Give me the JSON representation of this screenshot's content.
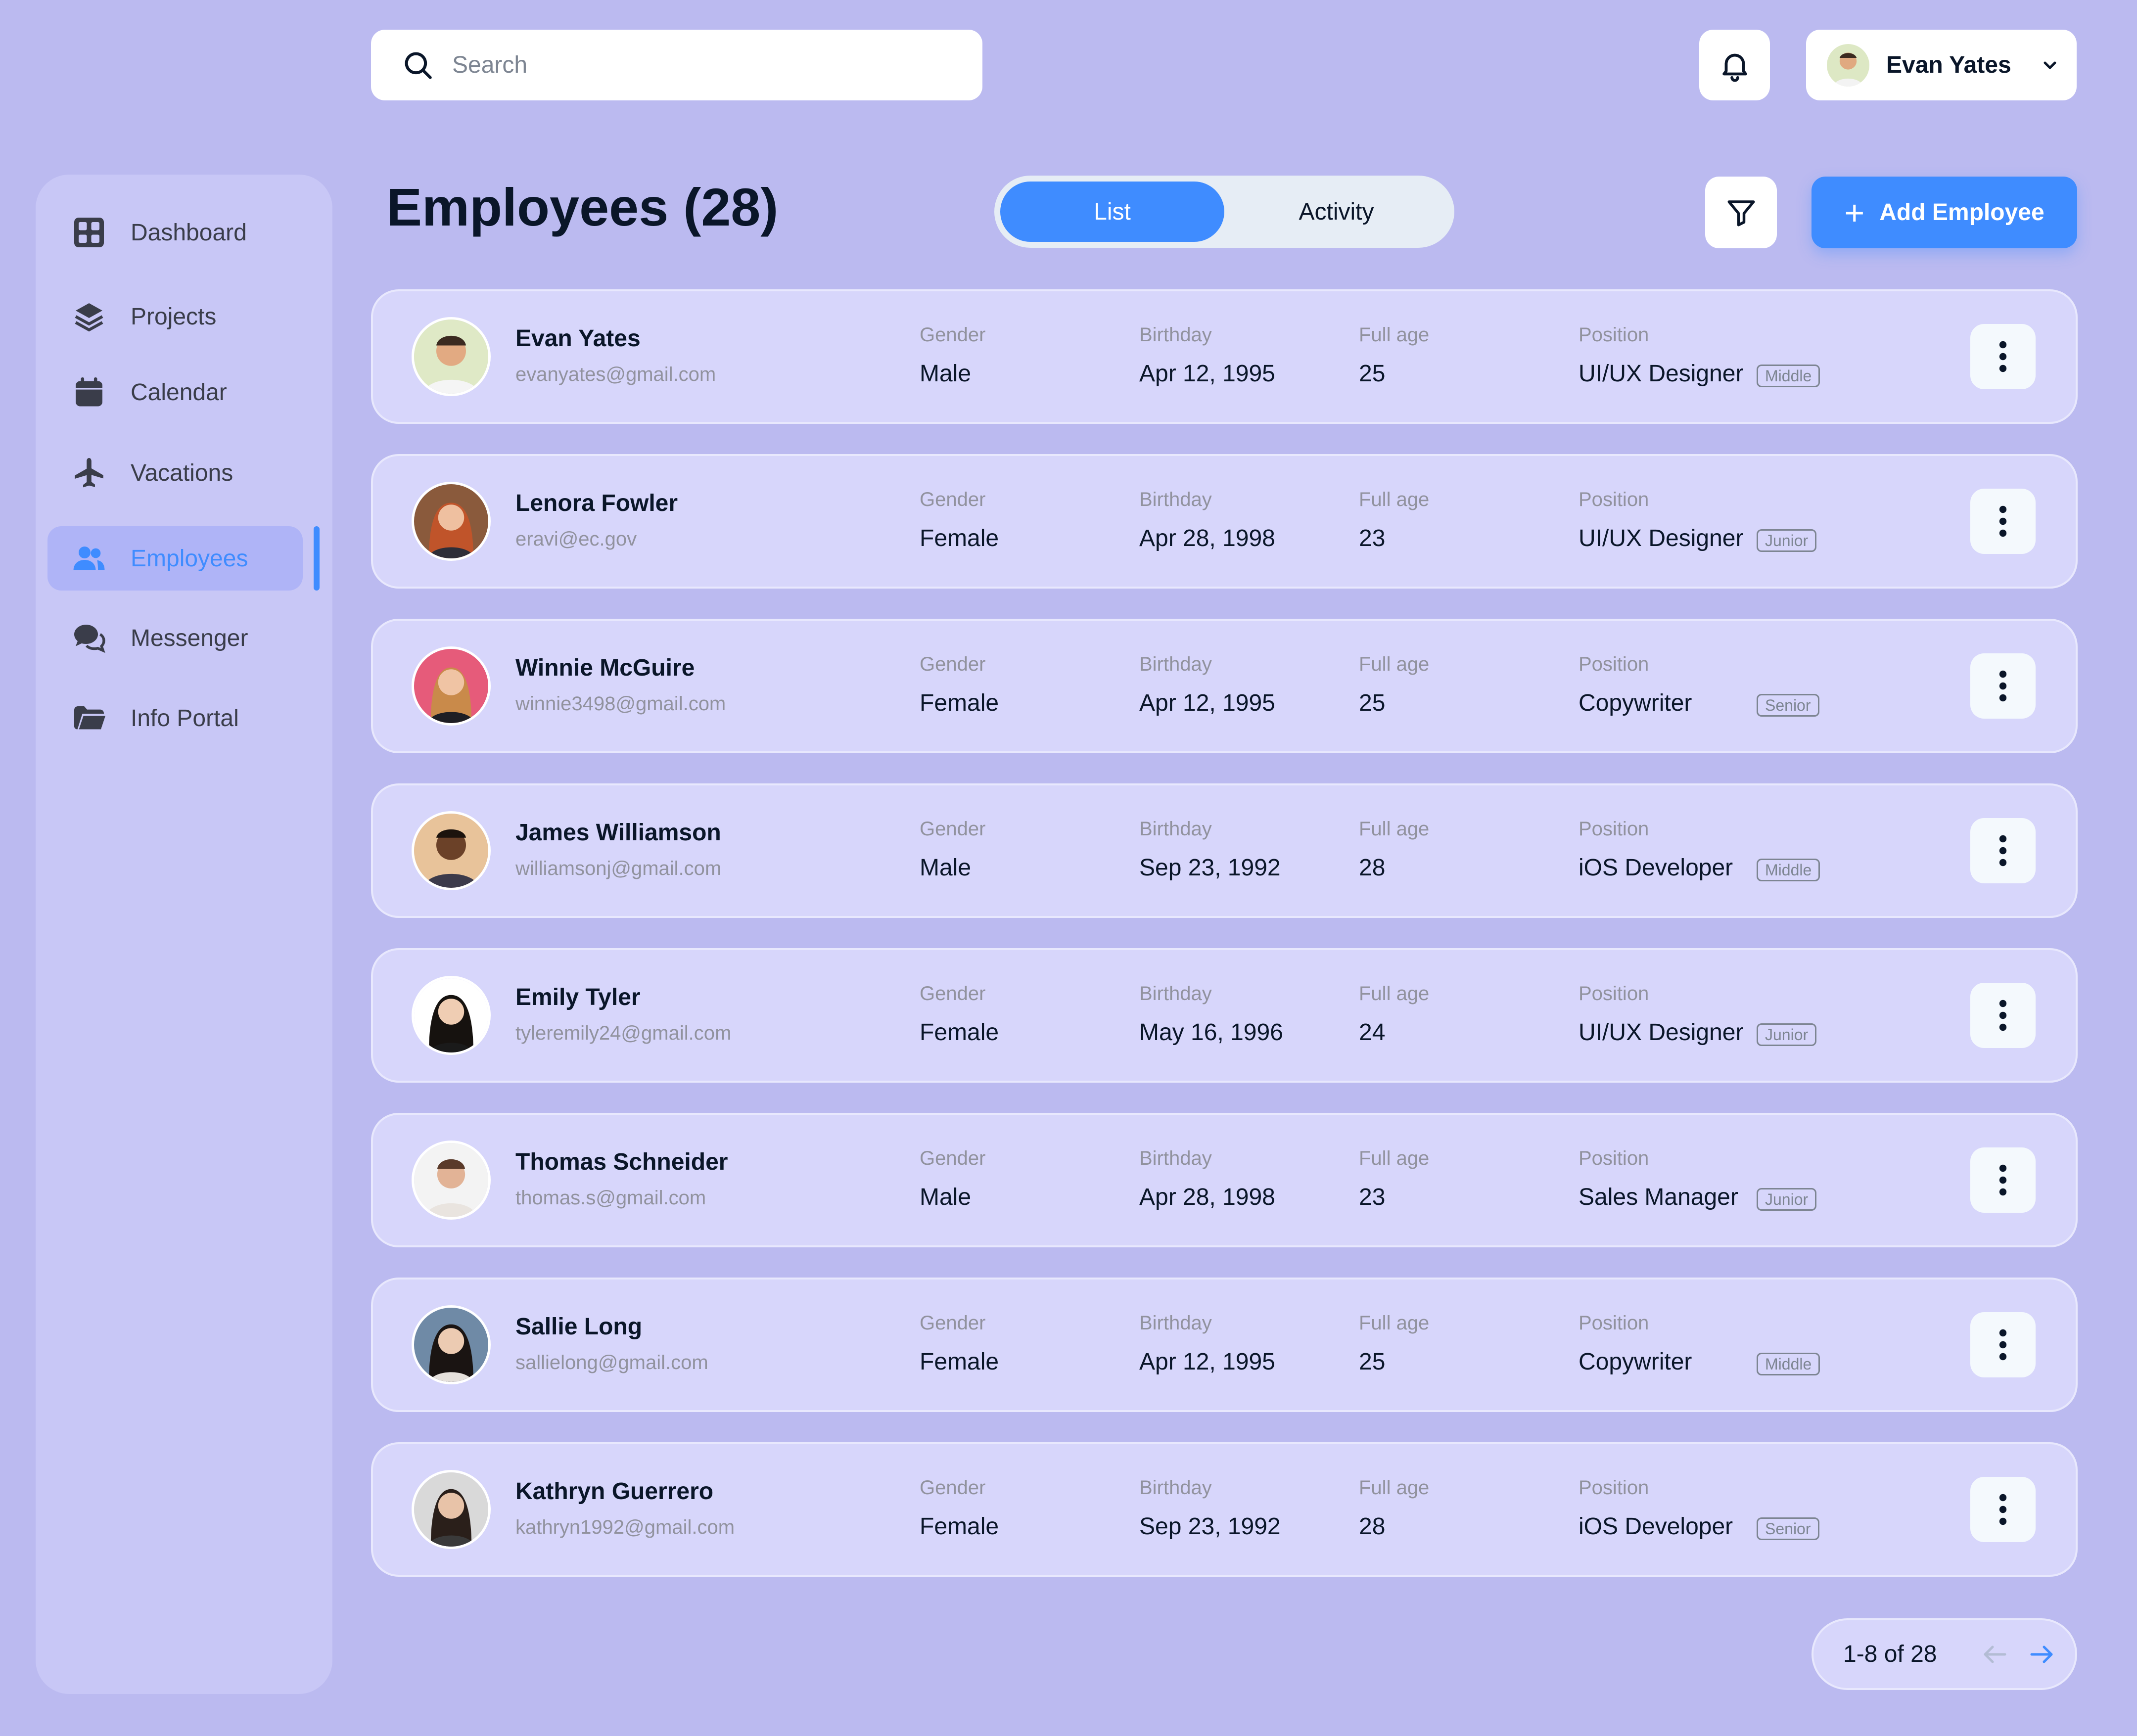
{
  "search": {
    "placeholder": "Search"
  },
  "user": {
    "name": "Evan Yates"
  },
  "sidebar": {
    "items": [
      {
        "label": "Dashboard",
        "icon": "dashboard-icon"
      },
      {
        "label": "Projects",
        "icon": "layers-icon"
      },
      {
        "label": "Calendar",
        "icon": "calendar-icon"
      },
      {
        "label": "Vacations",
        "icon": "airplane-icon"
      },
      {
        "label": "Employees",
        "icon": "users-icon",
        "active": true
      },
      {
        "label": "Messenger",
        "icon": "chat-icon"
      },
      {
        "label": "Info Portal",
        "icon": "folder-icon"
      }
    ]
  },
  "page": {
    "title": "Employees (28)",
    "tabs": [
      "List",
      "Activity"
    ],
    "active_tab": "List",
    "add_label": "Add Employee"
  },
  "columns": {
    "gender": "Gender",
    "birthday": "Birthday",
    "age": "Full age",
    "position": "Position"
  },
  "employees": [
    {
      "name": "Evan Yates",
      "email": "evanyates@gmail.com",
      "gender": "Male",
      "birthday": "Apr 12, 1995",
      "age": "25",
      "position": "UI/UX Designer",
      "level": "Middle"
    },
    {
      "name": "Lenora Fowler",
      "email": "eravi@ec.gov",
      "gender": "Female",
      "birthday": "Apr 28, 1998",
      "age": "23",
      "position": "UI/UX Designer",
      "level": "Junior"
    },
    {
      "name": "Winnie McGuire",
      "email": "winnie3498@gmail.com",
      "gender": "Female",
      "birthday": "Apr 12, 1995",
      "age": "25",
      "position": "Copywriter",
      "level": "Senior"
    },
    {
      "name": "James Williamson",
      "email": "williamsonj@gmail.com",
      "gender": "Male",
      "birthday": "Sep 23, 1992",
      "age": "28",
      "position": "iOS Developer",
      "level": "Middle"
    },
    {
      "name": "Emily Tyler",
      "email": "tyleremily24@gmail.com",
      "gender": "Female",
      "birthday": "May 16, 1996",
      "age": "24",
      "position": "UI/UX Designer",
      "level": "Junior"
    },
    {
      "name": "Thomas Schneider",
      "email": "thomas.s@gmail.com",
      "gender": "Male",
      "birthday": "Apr 28, 1998",
      "age": "23",
      "position": "Sales Manager",
      "level": "Junior"
    },
    {
      "name": "Sallie Long",
      "email": "sallielong@gmail.com",
      "gender": "Female",
      "birthday": "Apr 12, 1995",
      "age": "25",
      "position": "Copywriter",
      "level": "Middle"
    },
    {
      "name": "Kathryn Guerrero",
      "email": "kathryn1992@gmail.com",
      "gender": "Female",
      "birthday": "Sep 23, 1992",
      "age": "28",
      "position": "iOS Developer",
      "level": "Senior"
    }
  ],
  "pagination": {
    "text": "1-8 of 28"
  },
  "colors": {
    "background": "#bbbaf0",
    "accent": "#3f8cff",
    "text": "#0a1629",
    "muted": "#91929e"
  }
}
